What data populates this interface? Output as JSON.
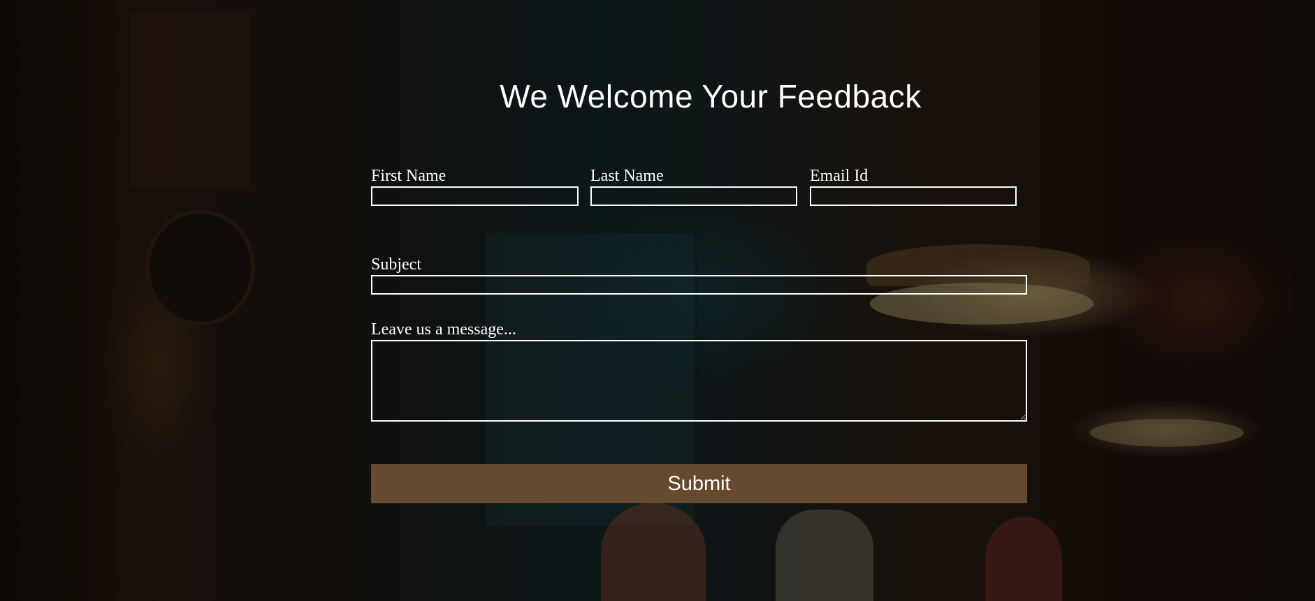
{
  "form": {
    "title": "We Welcome Your Feedback",
    "first_name": {
      "label": "First Name",
      "value": ""
    },
    "last_name": {
      "label": "Last Name",
      "value": ""
    },
    "email": {
      "label": "Email Id",
      "value": ""
    },
    "subject": {
      "label": "Subject",
      "value": ""
    },
    "message": {
      "label": "Leave us a message...",
      "value": ""
    },
    "submit_label": "Submit"
  },
  "colors": {
    "submit_background": "#664a30",
    "field_border": "#ffffff",
    "text": "#ffffff"
  }
}
